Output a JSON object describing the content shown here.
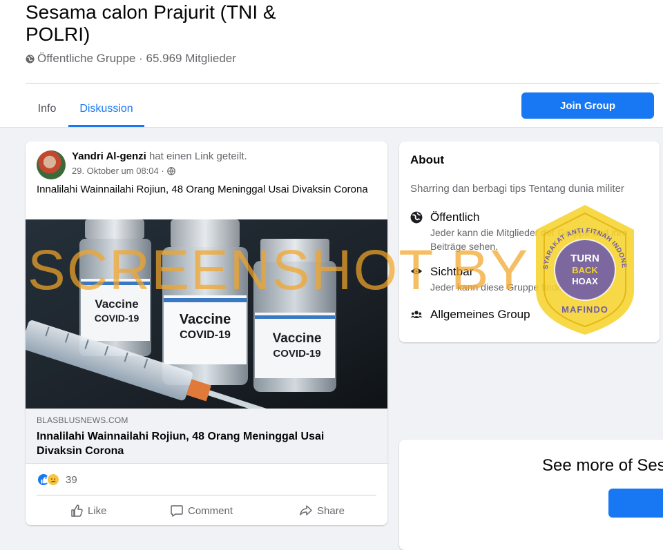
{
  "header": {
    "group_title": "Sesama calon Prajurit (TNI & POLRI)",
    "group_meta": "Öffentliche Gruppe · 65.969 Mitglieder",
    "tabs": [
      {
        "label": "Info",
        "active": false
      },
      {
        "label": "Diskussion",
        "active": true
      }
    ],
    "join_button": "Join Group",
    "accent_color": "#1877f2"
  },
  "post": {
    "author": "Yandri Al-genzi",
    "action_text": "hat einen Link geteilt.",
    "date": "29. Oktober um 08:04 ·",
    "privacy_icon": "globe-icon",
    "text": "Innalilahi Wainnailahi Rojiun, 48 Orang Meninggal Usai Divaksin Corona",
    "image_labels": {
      "vial_left": [
        "Vaccine",
        "COVID-19"
      ],
      "vial_center": [
        "Vaccine",
        "COVID-19"
      ],
      "vial_right": [
        "Vaccine",
        "COVID-19"
      ]
    },
    "link": {
      "domain": "BLASBLUSNEWS.COM",
      "title": "Innalilahi Wainnailahi Rojiun, 48 Orang Meninggal Usai Divaksin Corona"
    },
    "reactions": {
      "icons": [
        "like-reaction-icon",
        "sad-reaction-icon"
      ],
      "count": "39"
    },
    "actions": {
      "like": "Like",
      "comment": "Comment",
      "share": "Share"
    }
  },
  "about": {
    "title": "About",
    "description": "Sharring dan berbagi tips Tentang dunia militer",
    "items": [
      {
        "icon": "globe-icon",
        "heading": "Öffentlich",
        "sub": "Jeder kann die Mitglieder der Gruppe und ihre Beiträge sehen."
      },
      {
        "icon": "eye-icon",
        "heading": "Sichtbar",
        "sub": "Jeder kann diese Gruppe finden."
      },
      {
        "icon": "people-icon",
        "heading": "Allgemeines Group",
        "sub": ""
      }
    ]
  },
  "see_more": {
    "title": "See more of Ses"
  },
  "overlays": {
    "watermark_text": "SCREENSHOT BY",
    "watermark_color": "#f2a528",
    "stamp": {
      "center_text": [
        "TURN",
        "BACK",
        "HOAX"
      ],
      "ring_top": "MASYARAKAT ANTI FITNAH INDONESIA",
      "ring_bottom": "MAFINDO",
      "colors": {
        "gold": "#f6d32d",
        "purple": "#6e5ca8"
      }
    }
  }
}
